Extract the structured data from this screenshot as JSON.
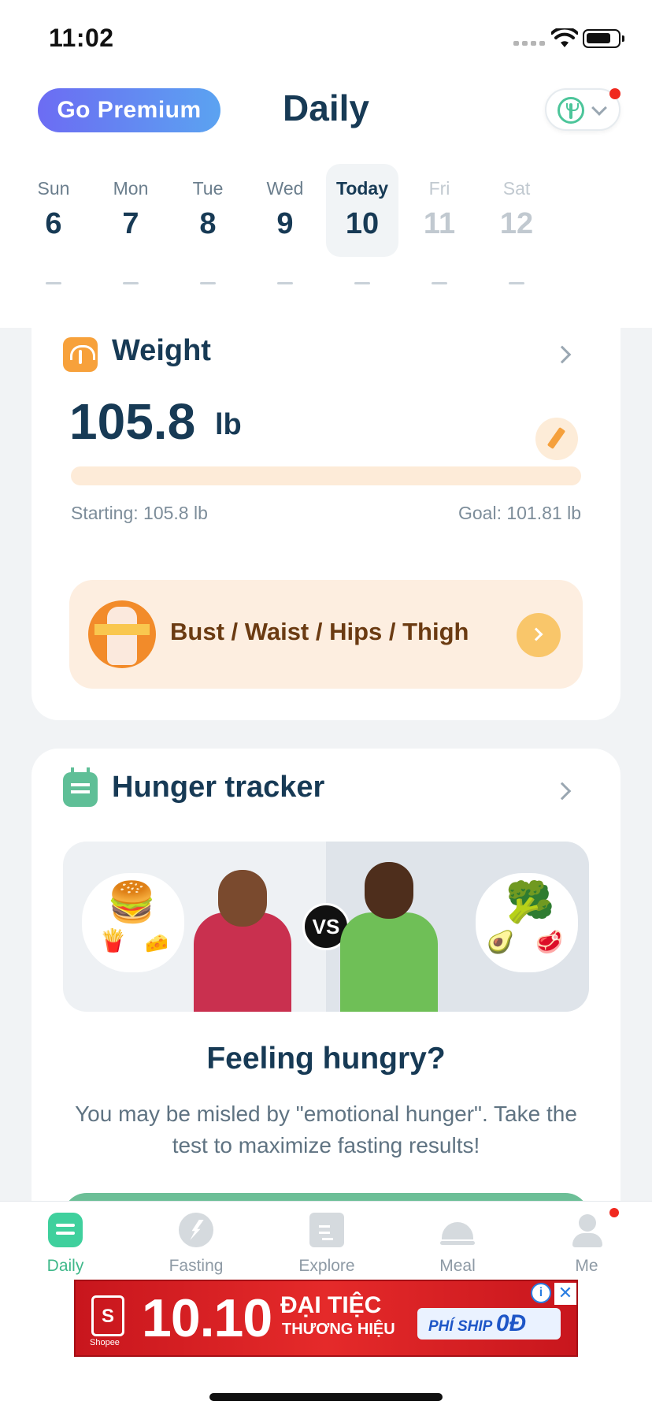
{
  "status_bar": {
    "time": "11:02"
  },
  "header": {
    "premium_label": "Go Premium",
    "title": "Daily",
    "plan_icon": "fasting-plan-icon",
    "has_notification": true
  },
  "week": [
    {
      "name": "Sun",
      "num": "6",
      "mark": "—"
    },
    {
      "name": "Mon",
      "num": "7",
      "mark": "—"
    },
    {
      "name": "Tue",
      "num": "8",
      "mark": "—"
    },
    {
      "name": "Wed",
      "num": "9",
      "mark": "—"
    },
    {
      "name": "Today",
      "num": "10",
      "mark": "—"
    },
    {
      "name": "Fri",
      "num": "11",
      "mark": "—"
    },
    {
      "name": "Sat",
      "num": "12",
      "mark": "—"
    }
  ],
  "weight": {
    "title": "Weight",
    "value": "105.8",
    "unit": "lb",
    "progress_fraction": 0,
    "starting": "Starting: 105.8 lb",
    "goal": "Goal: 101.81 lb",
    "banner_text": "Bust / Waist / Hips / Thigh"
  },
  "hunger": {
    "title": "Hunger tracker",
    "vs_label": "VS",
    "heading": "Feeling hungry?",
    "description": "You may be misled by \"emotional hunger\". Take the test to maximize fasting results!"
  },
  "tabs": [
    {
      "label": "Daily",
      "icon": "daily-icon",
      "active": true
    },
    {
      "label": "Fasting",
      "icon": "fasting-icon",
      "active": false
    },
    {
      "label": "Explore",
      "icon": "explore-icon",
      "active": false
    },
    {
      "label": "Meal",
      "icon": "meal-icon",
      "active": false
    },
    {
      "label": "Me",
      "icon": "me-icon",
      "active": false,
      "badge": true
    }
  ],
  "ad": {
    "brand": "Shopee",
    "brand_initial": "S",
    "date": "10.10",
    "line1": "ĐẠI TIỆC",
    "line2": "THƯƠNG HIỆU",
    "ship_prefix": "PHÍ SHIP",
    "ship_value": "0Đ",
    "info": "i",
    "close": "✕"
  },
  "colors": {
    "primary": "#173a55",
    "accent_green": "#3fb88a",
    "weight_orange": "#f5a03c",
    "premium_gradient_start": "#6c6cf3",
    "premium_gradient_end": "#5ba3f1"
  }
}
